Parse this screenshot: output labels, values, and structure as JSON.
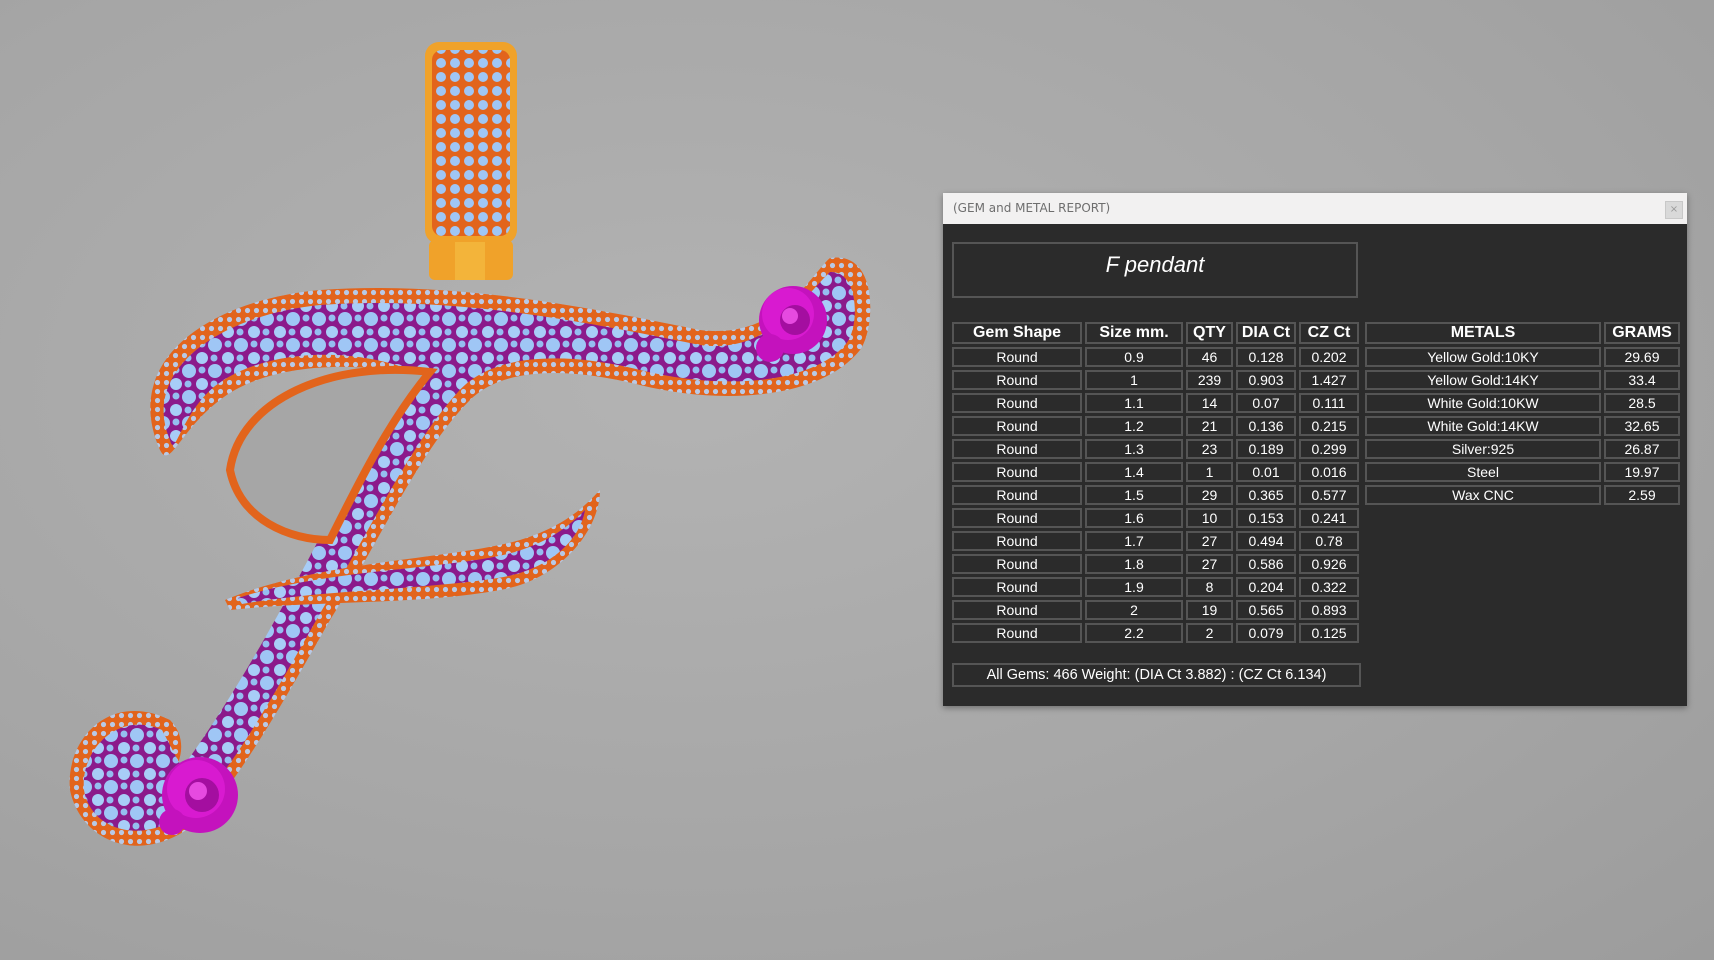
{
  "window": {
    "title": "(GEM and METAL REPORT)",
    "close_label": "×"
  },
  "report": {
    "title": "F pendant",
    "gem_headers": [
      "Gem Shape",
      "Size mm.",
      "QTY",
      "DIA Ct",
      "CZ Ct"
    ],
    "gems": [
      [
        "Round",
        "0.9",
        "46",
        "0.128",
        "0.202"
      ],
      [
        "Round",
        "1",
        "239",
        "0.903",
        "1.427"
      ],
      [
        "Round",
        "1.1",
        "14",
        "0.07",
        "0.111"
      ],
      [
        "Round",
        "1.2",
        "21",
        "0.136",
        "0.215"
      ],
      [
        "Round",
        "1.3",
        "23",
        "0.189",
        "0.299"
      ],
      [
        "Round",
        "1.4",
        "1",
        "0.01",
        "0.016"
      ],
      [
        "Round",
        "1.5",
        "29",
        "0.365",
        "0.577"
      ],
      [
        "Round",
        "1.6",
        "10",
        "0.153",
        "0.241"
      ],
      [
        "Round",
        "1.7",
        "27",
        "0.494",
        "0.78"
      ],
      [
        "Round",
        "1.8",
        "27",
        "0.586",
        "0.926"
      ],
      [
        "Round",
        "1.9",
        "8",
        "0.204",
        "0.322"
      ],
      [
        "Round",
        "2",
        "19",
        "0.565",
        "0.893"
      ],
      [
        "Round",
        "2.2",
        "2",
        "0.079",
        "0.125"
      ]
    ],
    "metal_headers": [
      "METALS",
      "GRAMS"
    ],
    "metals": [
      [
        "Yellow Gold:10KY",
        "29.69"
      ],
      [
        "Yellow Gold:14KY",
        "33.4"
      ],
      [
        "White Gold:10KW",
        "28.5"
      ],
      [
        "White Gold:14KW",
        "32.65"
      ],
      [
        "Silver:925",
        "26.87"
      ],
      [
        "Steel",
        "19.97"
      ],
      [
        "Wax  CNC",
        "2.59"
      ]
    ],
    "summary": "All Gems: 466  Weight: (DIA Ct 3.882) : (CZ Ct 6.134)"
  },
  "colors": {
    "background": "#a9a9a9",
    "panel": "#2b2b2b",
    "metal_orange": "#e2641c",
    "bail_gold": "#f0a22a",
    "enamel_magenta": "#8b1a8b",
    "gem_blue": "#9fc6f5",
    "rose_pink": "#d81ad0"
  }
}
